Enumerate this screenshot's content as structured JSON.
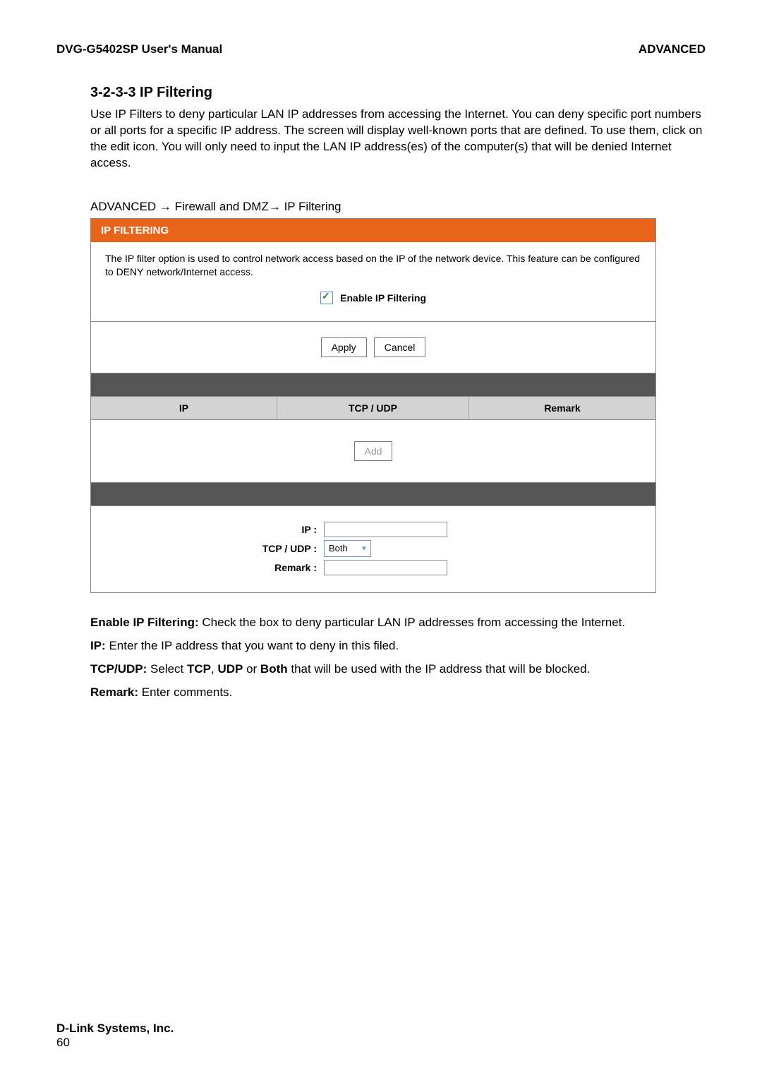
{
  "header": {
    "left": "DVG-G5402SP User's Manual",
    "right": "ADVANCED"
  },
  "section": {
    "number_title": "3-2-3-3 IP Filtering",
    "intro": "Use IP Filters to deny particular LAN IP addresses from accessing the Internet. You can deny specific port numbers or all ports for a specific IP address. The screen will display well-known ports that are defined. To use them, click on the edit icon. You will only need to input the LAN IP address(es) of the computer(s) that will be denied Internet access.",
    "breadcrumb": "ADVANCED  →  Firewall and DMZ→  IP Filtering"
  },
  "panel": {
    "title": "IP FILTERING",
    "description": "The IP filter option is used to control network access based on the IP of the network device. This feature can be configured to DENY network/Internet access.",
    "enable_label": "Enable IP Filtering",
    "apply_label": "Apply",
    "cancel_label": "Cancel",
    "columns": {
      "c1": "IP",
      "c2": "TCP / UDP",
      "c3": "Remark"
    },
    "add_label": "Add",
    "form": {
      "ip_label": "IP :",
      "tcpudp_label": "TCP / UDP :",
      "tcpudp_value": "Both",
      "remark_label": "Remark :"
    }
  },
  "definitions": {
    "d1_label": "Enable IP Filtering:",
    "d1_text": " Check the box to deny particular LAN IP addresses from accessing the Internet.",
    "d2_label": "IP:",
    "d2_text": " Enter the IP address that you want to deny in this filed.",
    "d3_label": "TCP/UDP:",
    "d3_pre": " Select ",
    "d3_b1": "TCP",
    "d3_b2": "UDP",
    "d3_b3": "Both",
    "d3_post": " that will be used with the IP address that will be blocked.",
    "d4_label": "Remark:",
    "d4_text": " Enter comments."
  },
  "footer": {
    "company": "D-Link Systems, Inc.",
    "page_no": "60"
  }
}
